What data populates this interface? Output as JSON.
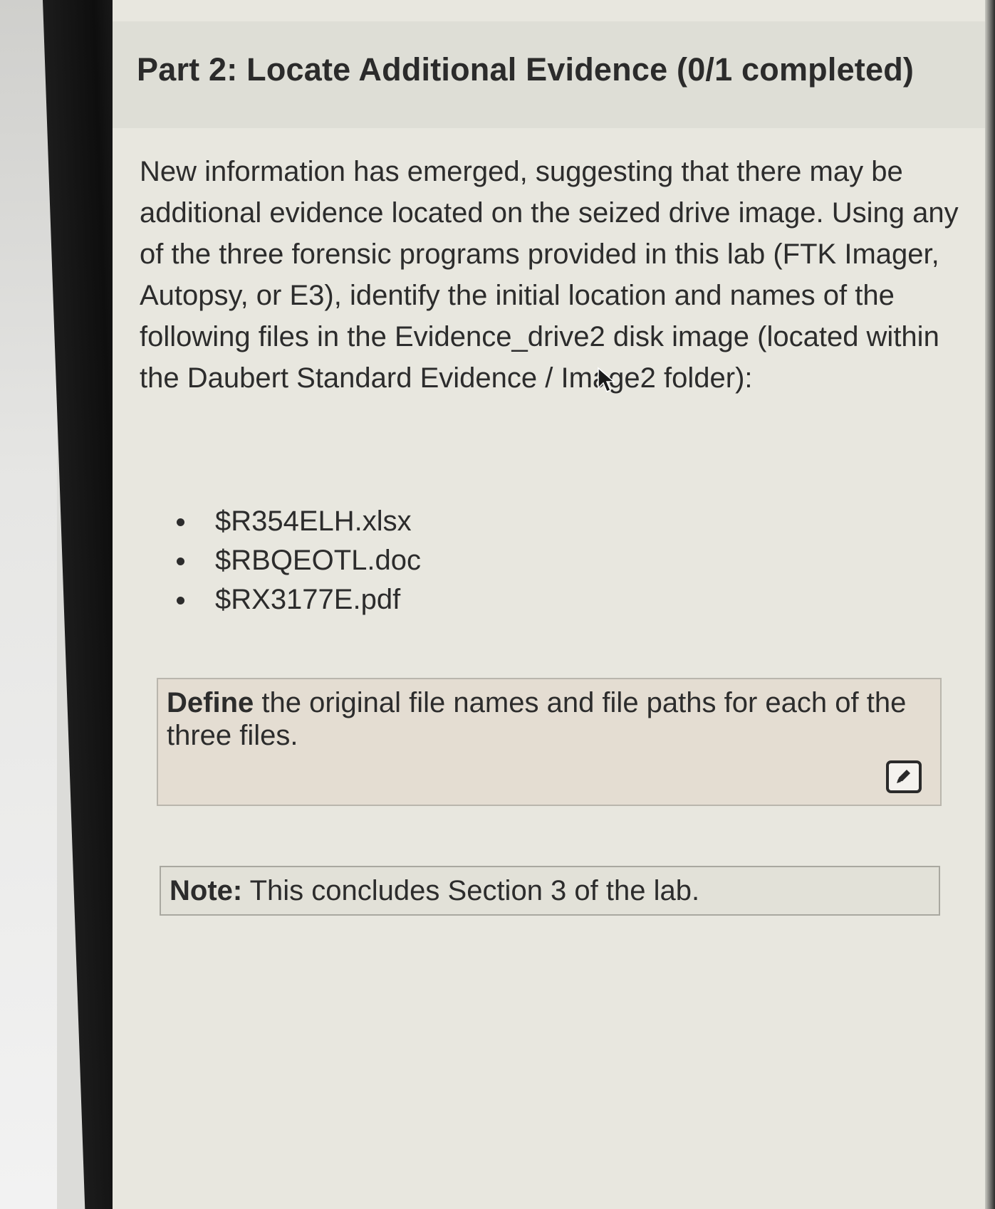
{
  "section": {
    "title": "Part 2: Locate Additional Evidence (0/1 completed)"
  },
  "intro": {
    "text": "New information has emerged, suggesting that there may be additional evidence located on the seized drive image. Using any of the three forensic programs provided in this lab (FTK Imager, Autopsy, or E3), identify the initial location and names of the following files in the Evidence_drive2 disk image (located within the Daubert Standard Evidence / Image2 folder):"
  },
  "files": [
    "$R354ELH.xlsx",
    "$RBQEOTL.doc",
    "$RX3177E.pdf"
  ],
  "question": {
    "bold_lead": "Define",
    "text": " the original file names and file paths for each of the three files.",
    "edit_icon": "edit-icon"
  },
  "note": {
    "bold_lead": "Note:",
    "text": " This concludes Section 3 of the lab."
  },
  "colors": {
    "background": "#e8e7df",
    "question_box": "#e4ddd2",
    "note_box": "#e2e1d8",
    "text": "#2c2c2c"
  }
}
